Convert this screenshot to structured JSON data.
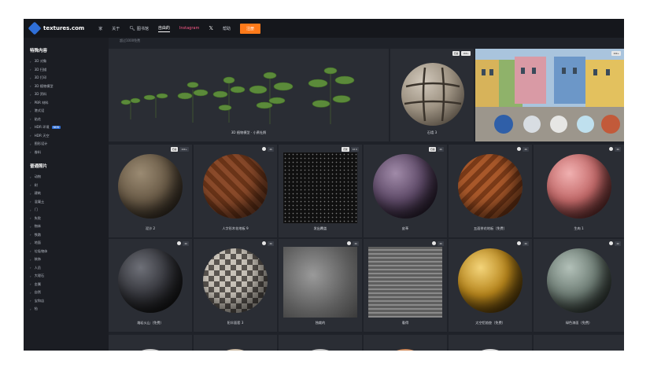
{
  "topbar": {
    "logo_text": "textures.com",
    "nav": [
      "家",
      "关于",
      "图书馆",
      "自由的",
      "Instagram",
      "帮助"
    ],
    "x_icon": "𝕏",
    "login": "注册",
    "accent": "#ff7a1a"
  },
  "breadcrumb": "超过1000免费",
  "sidebar": {
    "section1_title": "特殊内容",
    "section1_items": [
      "3D 对象",
      "3D 扫描",
      "3D 打印",
      "3D 植物模型",
      "3D 资料",
      "PBR 材料",
      "港式设",
      "贴花",
      "HDR 环境",
      "HDR 天空",
      "图形设计",
      "香料"
    ],
    "new_badge": "NEW",
    "section2_title": "普通照片",
    "section2_items": [
      "动物",
      "树",
      "建筑",
      "混凝土",
      "门",
      "失败",
      "物体",
      "铁路",
      "地面",
      "垃圾物体",
      "装饰",
      "人员",
      "大理石",
      "金属",
      "自然",
      "宝和店",
      "毡"
    ]
  },
  "tiles": {
    "plants_label": "3D 植物模型 · 小黄杜鹃",
    "stone_label": "石墙 3",
    "stone_badges": [
      "扫描",
      "16K+"
    ],
    "hdr_badge": "16K+",
    "row2": [
      {
        "label": "泥沙 2",
        "badges": [
          "扫描",
          "16K+"
        ]
      },
      {
        "label": "人字形木花地板 9",
        "badges": [
          "",
          "4K"
        ]
      },
      {
        "label": "发出覆盖",
        "badges": [
          "花板",
          "16 K"
        ]
      },
      {
        "label": "皮革",
        "badges": [
          "扫描",
          "4K"
        ]
      },
      {
        "label": "五面拼花地板（免费）",
        "badges": [
          "",
          "4K"
        ]
      },
      {
        "label": "生肉 1",
        "badges": [
          "",
          "4K"
        ]
      }
    ],
    "row3": [
      {
        "label": "熔岩火山（免费）",
        "badges": [
          "",
          "4K"
        ]
      },
      {
        "label": "阳伞面套 3",
        "badges": [
          "",
          "4K"
        ]
      },
      {
        "label": "独裁的",
        "badges": [
          "",
          "4K"
        ]
      },
      {
        "label": "看得",
        "badges": [
          "",
          "4K"
        ]
      },
      {
        "label": "太空铝箔垫（免费）",
        "badges": [
          "",
          "4K"
        ]
      },
      {
        "label": "绿色漆面（免费）",
        "badges": [
          "",
          "4K"
        ]
      }
    ]
  }
}
